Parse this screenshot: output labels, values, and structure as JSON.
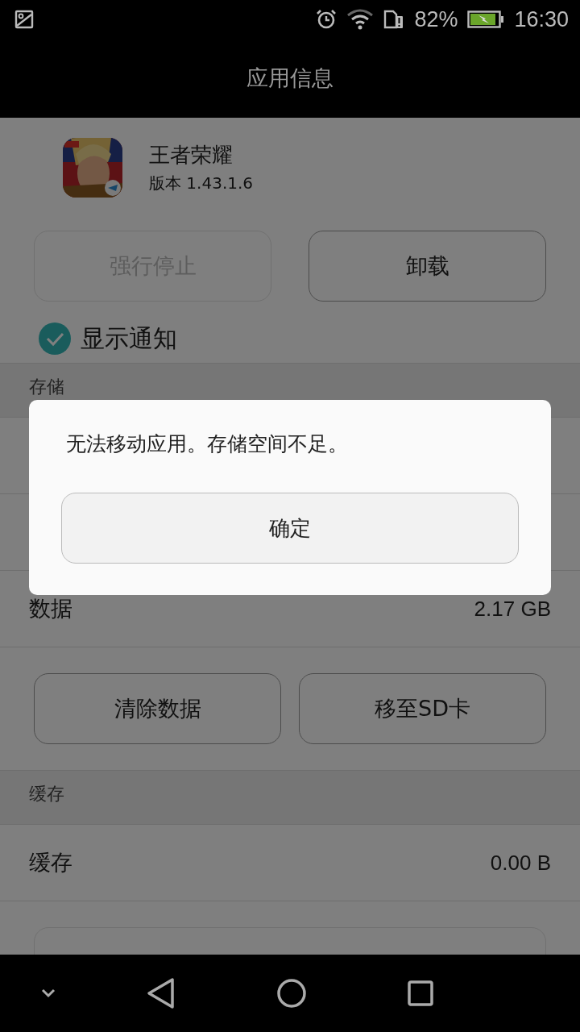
{
  "status_bar": {
    "battery_percent": "82%",
    "charging": true,
    "time": "16:30"
  },
  "title": "应用信息",
  "app": {
    "name": "王者荣耀",
    "version": "版本 1.43.1.6"
  },
  "action_buttons": [
    {
      "label": "强行停止",
      "disabled": true
    },
    {
      "label": "卸载",
      "disabled": false
    }
  ],
  "show_notifications": {
    "label": "显示通知",
    "checked": true
  },
  "storage": {
    "header": "存储",
    "rows": [
      {
        "label": "数据",
        "value": "2.17 GB"
      }
    ],
    "buttons": [
      {
        "label": "清除数据",
        "disabled": false
      },
      {
        "label": "移至SD卡",
        "disabled": false
      }
    ]
  },
  "cache": {
    "header": "缓存",
    "rows": [
      {
        "label": "缓存",
        "value": "0.00 B"
      }
    ],
    "buttons": [
      {
        "disabled": true
      }
    ]
  },
  "dialog": {
    "message": "无法移动应用。存储空间不足。",
    "button": "确定"
  }
}
